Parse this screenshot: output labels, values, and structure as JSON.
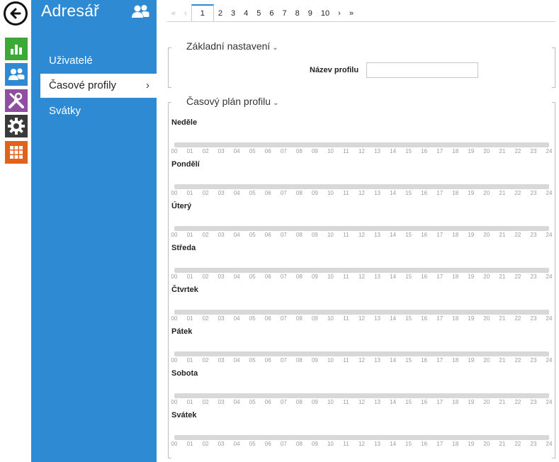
{
  "app": {
    "title": "Adresář"
  },
  "rail": {
    "back_icon": "arrow-left-icon",
    "items": [
      {
        "name": "rail-status-button",
        "icon": "bar-chart-icon",
        "color": "#3aa935"
      },
      {
        "name": "rail-directory-button",
        "icon": "users-icon",
        "color": "#2e8bd3"
      },
      {
        "name": "rail-hardware-button",
        "icon": "tools-icon",
        "color": "#8e4fa0"
      },
      {
        "name": "rail-settings-button",
        "icon": "gear-icon",
        "color": "#3a3a3a"
      },
      {
        "name": "rail-services-button",
        "icon": "grid-icon",
        "color": "#e1621b"
      }
    ]
  },
  "sidebar": {
    "items": [
      {
        "label": "Uživatelé",
        "active": false
      },
      {
        "label": "Časové profily",
        "active": true,
        "chevron": "›"
      },
      {
        "label": "Svátky",
        "active": false
      }
    ]
  },
  "pager": {
    "first": "«",
    "prev": "‹",
    "pages": [
      "1",
      "2",
      "3",
      "4",
      "5",
      "6",
      "7",
      "8",
      "9",
      "10"
    ],
    "current": "1",
    "next": "›",
    "last": "»"
  },
  "basic": {
    "title": "Základní nastavení",
    "caret": "⌄",
    "profile_name_label": "Název profilu",
    "profile_name_value": ""
  },
  "schedule": {
    "title": "Časový plán profilu",
    "caret": "⌄",
    "days": [
      "Neděle",
      "Pondělí",
      "Úterý",
      "Středa",
      "Čtvrtek",
      "Pátek",
      "Sobota",
      "Svátek"
    ],
    "hours": [
      "00",
      "01",
      "02",
      "03",
      "04",
      "05",
      "06",
      "07",
      "08",
      "09",
      "10",
      "11",
      "12",
      "13",
      "14",
      "15",
      "16",
      "17",
      "18",
      "19",
      "20",
      "21",
      "22",
      "23",
      "24"
    ]
  },
  "colors": {
    "accent": "#2e8bd3",
    "bar": "#d8d8d8",
    "tick": "#9a9a9a"
  }
}
